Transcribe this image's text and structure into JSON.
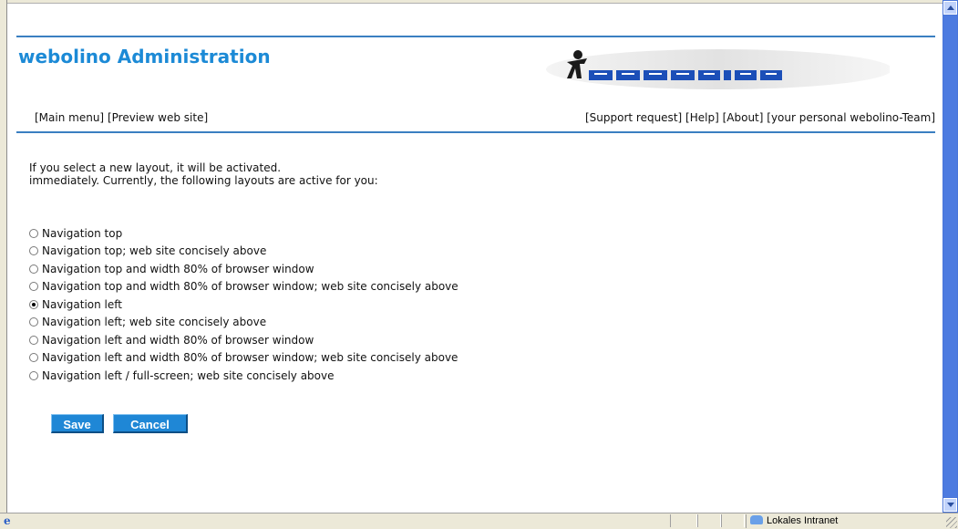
{
  "page": {
    "title": "webolino Administration",
    "logo_text": "WEBOLINO"
  },
  "nav": {
    "left": [
      {
        "label": "[Main menu]"
      },
      {
        "label": "[Preview web site]"
      }
    ],
    "right": [
      {
        "label": "[Support request]"
      },
      {
        "label": "[Help]"
      },
      {
        "label": "[About]"
      },
      {
        "label": "[your personal webolino-Team]"
      }
    ]
  },
  "intro": {
    "line1": "If you select a new layout, it will be activated.",
    "line2": "immediately. Currently, the following layouts are active for you:"
  },
  "layouts": {
    "selected_index": 4,
    "options": [
      "Navigation top",
      "Navigation top; web site concisely above",
      "Navigation top and width 80% of browser window",
      "Navigation top and width 80% of browser window; web site concisely above",
      "Navigation left",
      "Navigation left; web site concisely above",
      "Navigation left and width 80% of browser window",
      "Navigation left and width 80% of browser window; web site concisely above",
      "Navigation left / full-screen; web site concisely above"
    ]
  },
  "buttons": {
    "save": "Save",
    "cancel": "Cancel"
  },
  "statusbar": {
    "zone": "Lokales Intranet"
  },
  "colors": {
    "accent": "#1c8ad6",
    "rule": "#3a7fc1",
    "button": "#1f87d6"
  }
}
